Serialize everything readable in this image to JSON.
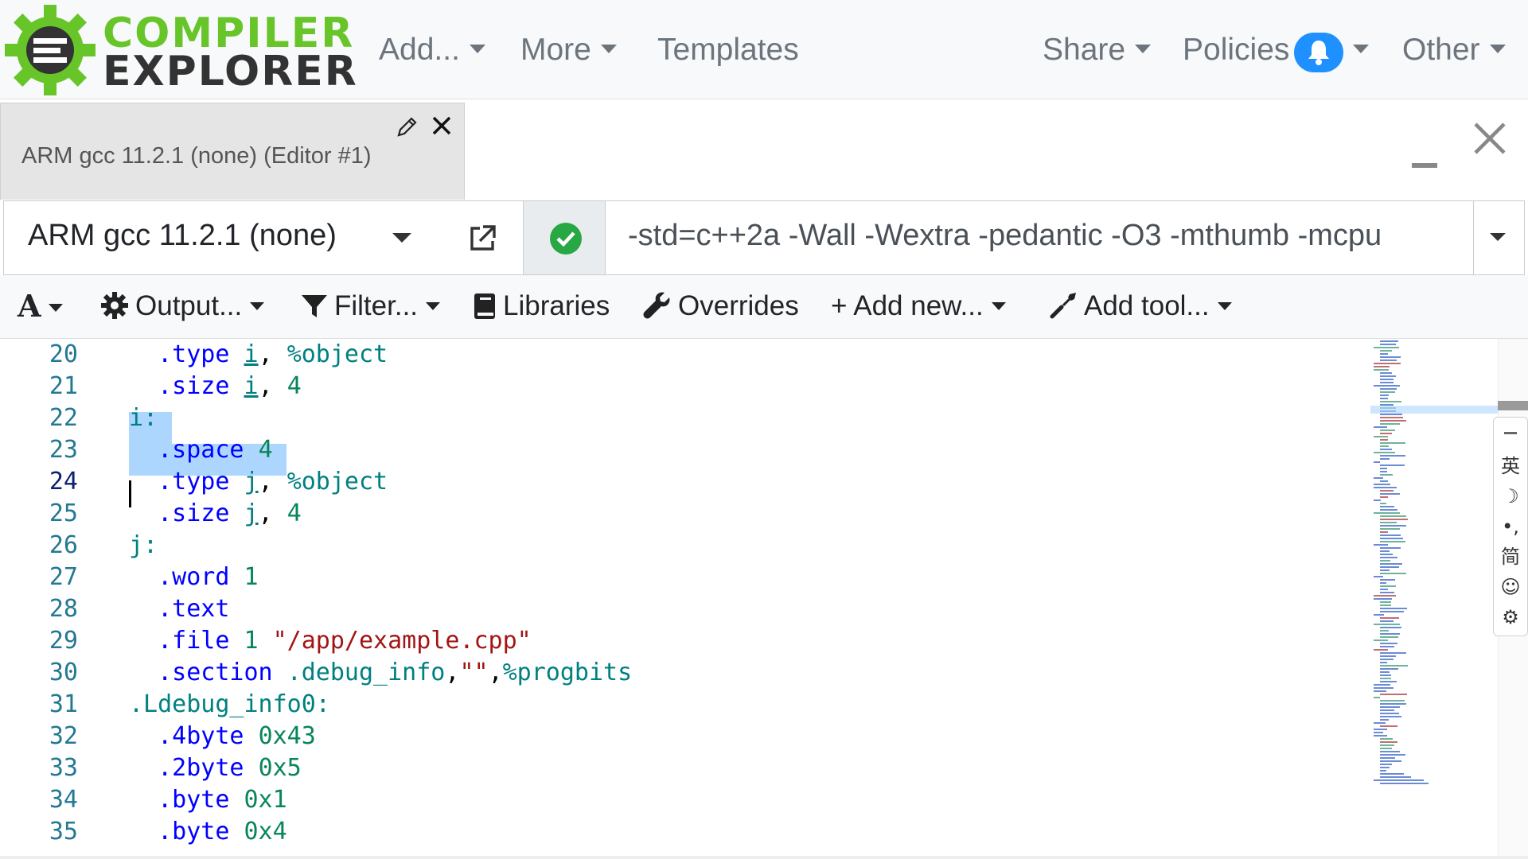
{
  "logo": {
    "line1": "COMPILER",
    "line2": "EXPLORER"
  },
  "nav": {
    "add": "Add...",
    "more": "More",
    "templates": "Templates",
    "share": "Share",
    "policies": "Policies",
    "other": "Other"
  },
  "tab": {
    "title": "ARM gcc 11.2.1 (none) (Editor #1)"
  },
  "compiler": {
    "name": "ARM gcc 11.2.1 (none)",
    "flags": "-std=c++2a -Wall -Wextra -pedantic -O3 -mthumb -mcpu"
  },
  "toolbar": {
    "font": "A",
    "output": "Output...",
    "filter": "Filter...",
    "libraries": "Libraries",
    "overrides": "Overrides",
    "add_new": "+ Add new...",
    "add_tool": "Add tool..."
  },
  "code": [
    {
      "n": "20",
      "t": [
        [
          "  ",
          "p"
        ],
        [
          ".type",
          "d"
        ],
        [
          " ",
          "p"
        ],
        [
          "i",
          "l u"
        ],
        [
          ", ",
          "p"
        ],
        [
          "%object",
          "l"
        ]
      ]
    },
    {
      "n": "21",
      "t": [
        [
          "  ",
          "p"
        ],
        [
          ".size",
          "d"
        ],
        [
          " ",
          "p"
        ],
        [
          "i",
          "l u"
        ],
        [
          ", ",
          "p"
        ],
        [
          "4",
          "a"
        ]
      ]
    },
    {
      "n": "22",
      "t": [
        [
          "i:",
          "l"
        ]
      ]
    },
    {
      "n": "23",
      "t": [
        [
          "  ",
          "p"
        ],
        [
          ".space",
          "d"
        ],
        [
          " ",
          "p"
        ],
        [
          "4",
          "a"
        ]
      ]
    },
    {
      "n": "24",
      "t": [
        [
          "  ",
          "p"
        ],
        [
          ".type",
          "d"
        ],
        [
          " ",
          "p"
        ],
        [
          "j",
          "l u"
        ],
        [
          ", ",
          "p"
        ],
        [
          "%object",
          "l"
        ]
      ]
    },
    {
      "n": "25",
      "t": [
        [
          "  ",
          "p"
        ],
        [
          ".size",
          "d"
        ],
        [
          " ",
          "p"
        ],
        [
          "j",
          "l u"
        ],
        [
          ", ",
          "p"
        ],
        [
          "4",
          "a"
        ]
      ]
    },
    {
      "n": "26",
      "t": [
        [
          "j:",
          "l"
        ]
      ]
    },
    {
      "n": "27",
      "t": [
        [
          "  ",
          "p"
        ],
        [
          ".word",
          "d"
        ],
        [
          " ",
          "p"
        ],
        [
          "1",
          "a"
        ]
      ]
    },
    {
      "n": "28",
      "t": [
        [
          "  ",
          "p"
        ],
        [
          ".text",
          "d"
        ]
      ]
    },
    {
      "n": "29",
      "t": [
        [
          "  ",
          "p"
        ],
        [
          ".file",
          "d"
        ],
        [
          " ",
          "p"
        ],
        [
          "1",
          "a"
        ],
        [
          " ",
          "p"
        ],
        [
          "\"/app/example.cpp\"",
          "s"
        ]
      ]
    },
    {
      "n": "30",
      "t": [
        [
          "  ",
          "p"
        ],
        [
          ".section",
          "d"
        ],
        [
          " ",
          "p"
        ],
        [
          ".debug_info",
          "l"
        ],
        [
          ",",
          "p"
        ],
        [
          "\"\"",
          "s"
        ],
        [
          ",",
          "p"
        ],
        [
          "%progbits",
          "l"
        ]
      ]
    },
    {
      "n": "31",
      "t": [
        [
          ".Ldebug_info0:",
          "l"
        ]
      ]
    },
    {
      "n": "32",
      "t": [
        [
          "  ",
          "p"
        ],
        [
          ".4byte",
          "d"
        ],
        [
          " ",
          "p"
        ],
        [
          "0x43",
          "a"
        ]
      ]
    },
    {
      "n": "33",
      "t": [
        [
          "  ",
          "p"
        ],
        [
          ".2byte",
          "d"
        ],
        [
          " ",
          "p"
        ],
        [
          "0x5",
          "a"
        ]
      ]
    },
    {
      "n": "34",
      "t": [
        [
          "  ",
          "p"
        ],
        [
          ".byte",
          "d"
        ],
        [
          " ",
          "p"
        ],
        [
          "0x1",
          "a"
        ]
      ]
    },
    {
      "n": "35",
      "t": [
        [
          "  ",
          "p"
        ],
        [
          ".byte",
          "d"
        ],
        [
          " ",
          "p"
        ],
        [
          "0x4",
          "a"
        ]
      ]
    }
  ],
  "current_line": "24",
  "ime": [
    "英",
    "☽",
    "•,",
    "简",
    "☺",
    "⚙"
  ],
  "colors": {
    "accent": "#67c52a",
    "bell": "#1e90ff",
    "ok": "#28a745"
  }
}
